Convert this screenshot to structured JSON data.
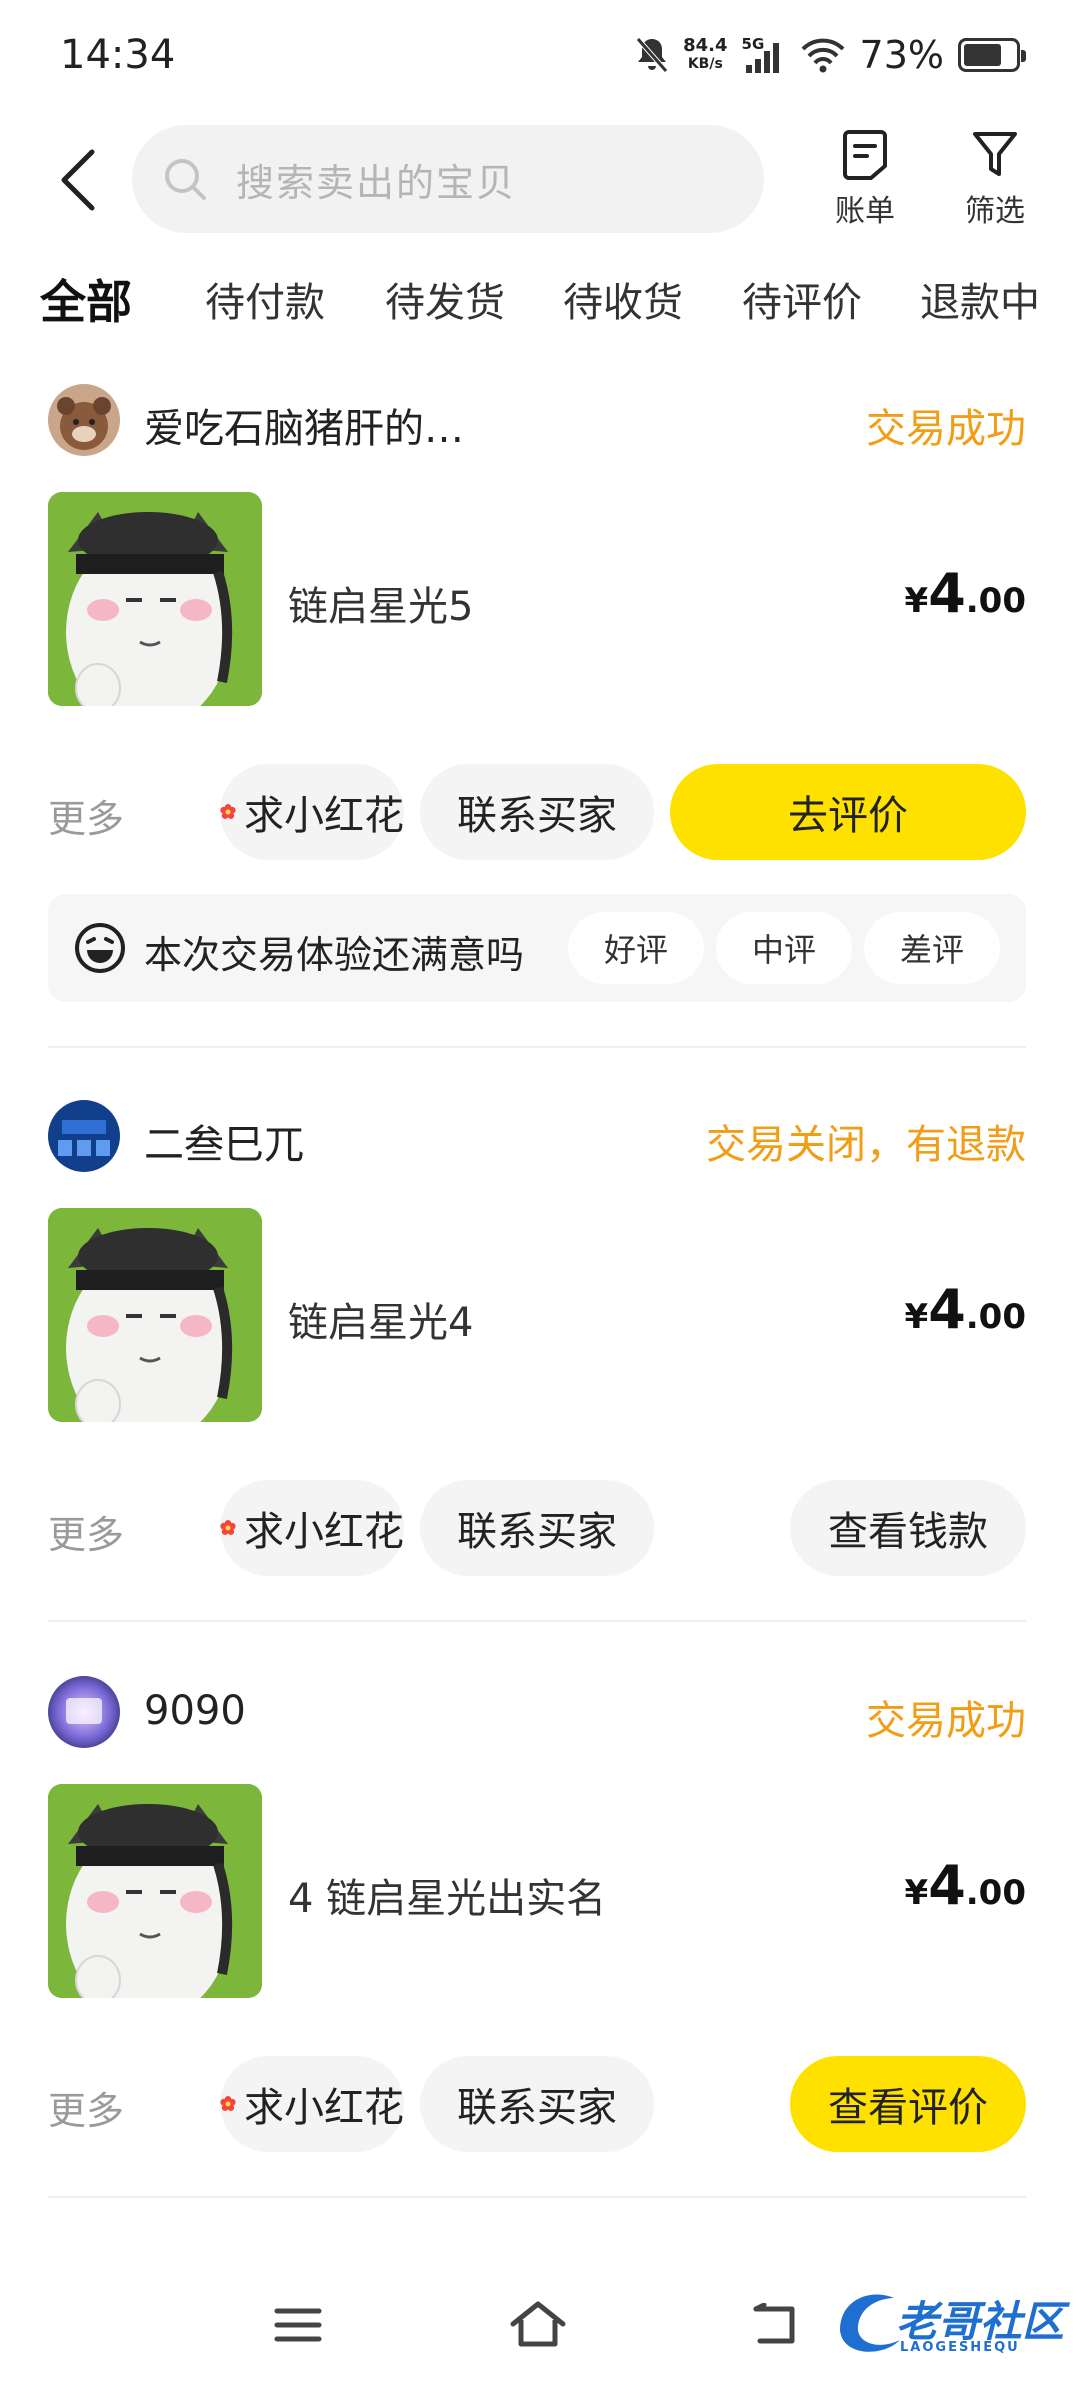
{
  "status_bar": {
    "time": "14:34",
    "net_speed_value": "84.4",
    "net_speed_unit": "KB/s",
    "network_type": "5G",
    "battery_percent": "73%",
    "battery_level": 0.73
  },
  "header": {
    "search_placeholder": "搜索卖出的宝贝",
    "bill_label": "账单",
    "filter_label": "筛选"
  },
  "tabs": [
    {
      "label": "全部",
      "active": true
    },
    {
      "label": "待付款",
      "active": false
    },
    {
      "label": "待发货",
      "active": false
    },
    {
      "label": "待收货",
      "active": false
    },
    {
      "label": "待评价",
      "active": false
    },
    {
      "label": "退款中",
      "active": false
    }
  ],
  "orders": [
    {
      "seller_name": "爱吃石脑猪肝的…",
      "status": "交易成功",
      "item_title": "链启星光5",
      "price_yen": "¥",
      "price_int": "4",
      "price_dec": ".00",
      "more_label": "更多",
      "btn_flower": "求小红花",
      "btn_contact": "联系买家",
      "btn_primary": "去评价",
      "rating": {
        "question": "本次交易体验还满意吗",
        "good": "好评",
        "neutral": "中评",
        "bad": "差评"
      }
    },
    {
      "seller_name": "二叁巳兀",
      "status": "交易关闭，有退款",
      "item_title": "链启星光4",
      "price_yen": "¥",
      "price_int": "4",
      "price_dec": ".00",
      "more_label": "更多",
      "btn_flower": "求小红花",
      "btn_contact": "联系买家",
      "btn_primary": "查看钱款"
    },
    {
      "seller_name": "9090",
      "status": "交易成功",
      "item_title": "4 链启星光出实名",
      "price_yen": "¥",
      "price_int": "4",
      "price_dec": ".00",
      "more_label": "更多",
      "btn_flower": "求小红花",
      "btn_contact": "联系买家",
      "btn_primary": "查看评价"
    }
  ],
  "watermark": {
    "text": "老哥社区",
    "sub": "LAOGESHEQU"
  },
  "colors": {
    "accent_yellow": "#ffe100",
    "status_orange": "#f29d16",
    "pill_gray": "#f4f4f4"
  }
}
